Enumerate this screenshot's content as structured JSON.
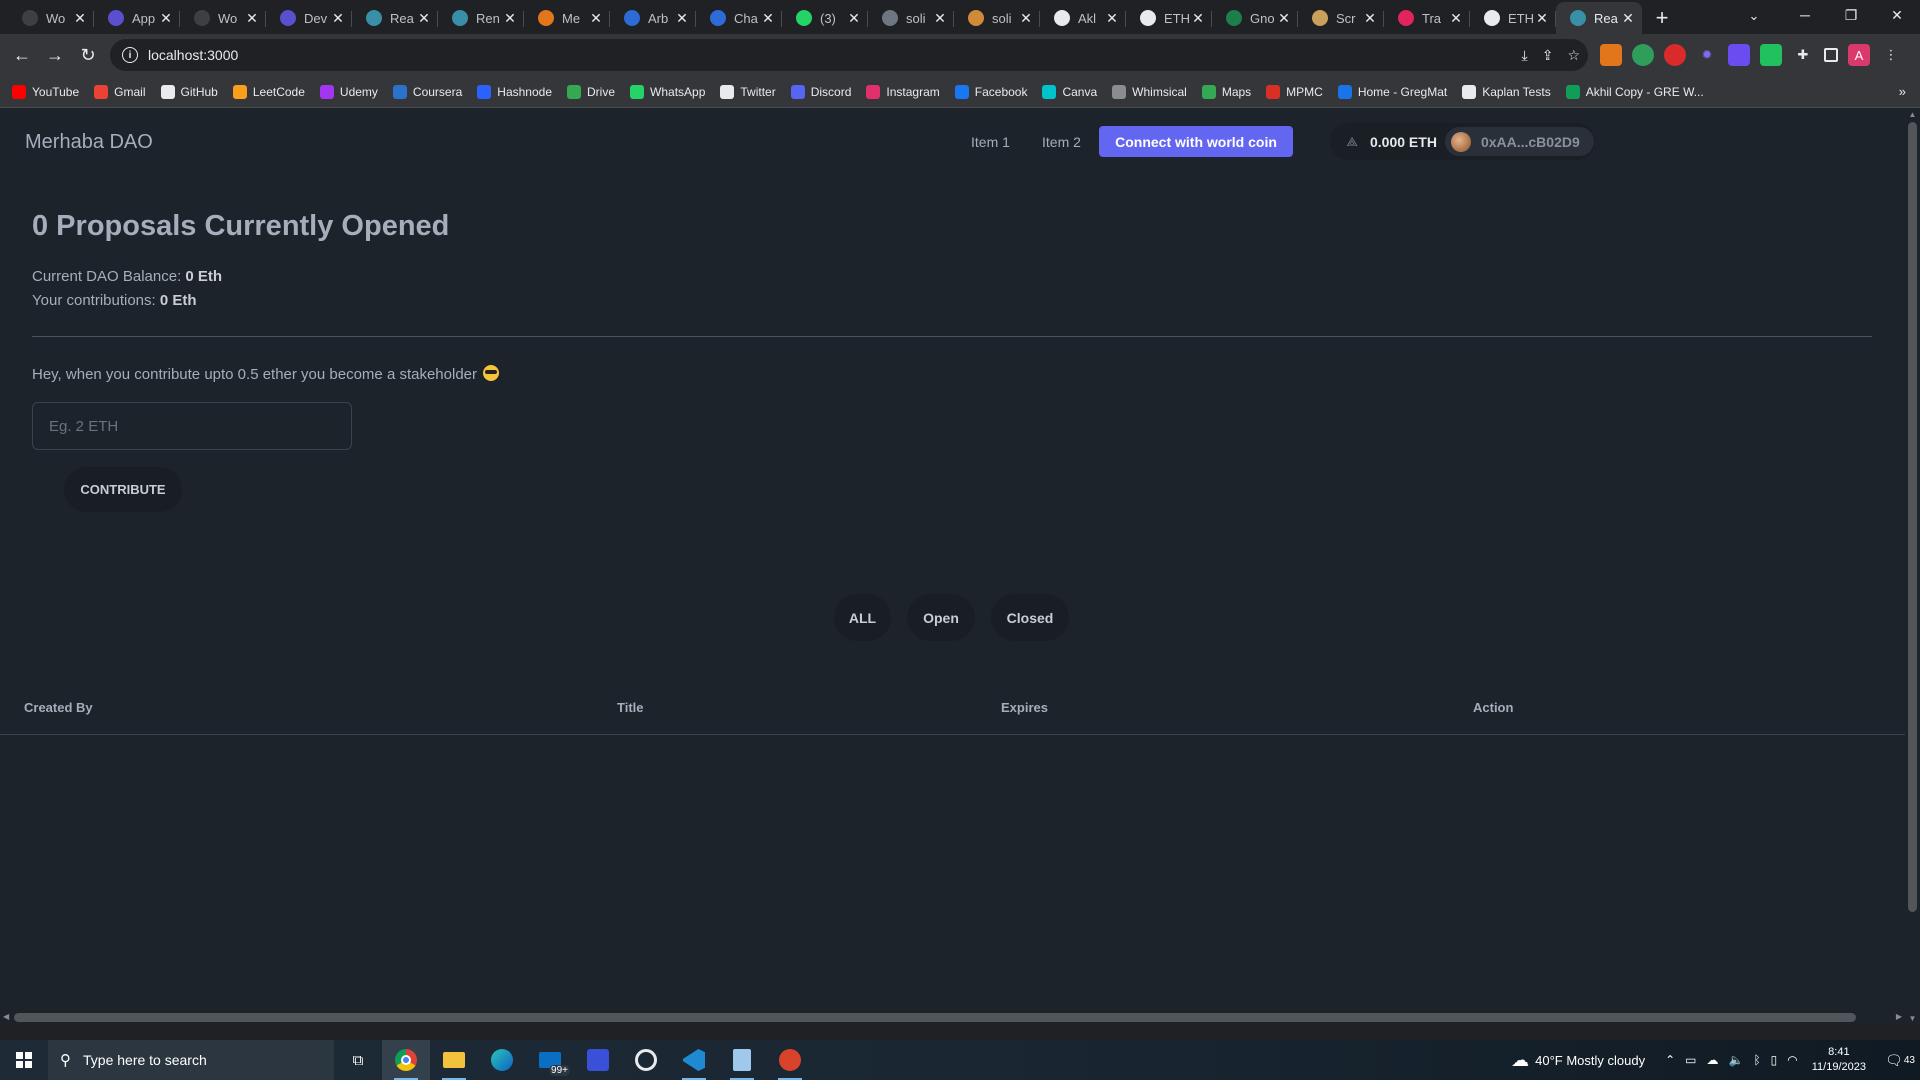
{
  "browser": {
    "tabs": [
      {
        "title": "Wo",
        "color": "#3c4043"
      },
      {
        "title": "App",
        "color": "#5a4fcf"
      },
      {
        "title": "Wo",
        "color": "#3c4043"
      },
      {
        "title": "Dev",
        "color": "#5a4fcf"
      },
      {
        "title": "Rea",
        "color": "#3a8fa8"
      },
      {
        "title": "Ren",
        "color": "#3a8fa8"
      },
      {
        "title": "Me",
        "color": "#e2761b"
      },
      {
        "title": "Arb",
        "color": "#2d6bd6"
      },
      {
        "title": "Cha",
        "color": "#2d6bd6"
      },
      {
        "title": "(3)",
        "color": "#25d366"
      },
      {
        "title": "soli",
        "color": "#6e7681"
      },
      {
        "title": "soli",
        "color": "#d08a3a"
      },
      {
        "title": "Akl",
        "color": "#e8eaed"
      },
      {
        "title": "ETH",
        "color": "#e8eaed"
      },
      {
        "title": "Gno",
        "color": "#1a7f4b"
      },
      {
        "title": "Scr",
        "color": "#c9a15b"
      },
      {
        "title": "Tra",
        "color": "#e0245e"
      },
      {
        "title": "ETH",
        "color": "#e8eaed"
      },
      {
        "title": "Rea",
        "color": "#3a8fa8"
      }
    ],
    "active_tab_index": 18,
    "url": "localhost:3000",
    "bookmarks": [
      {
        "label": "YouTube",
        "color": "#ff0000"
      },
      {
        "label": "Gmail",
        "color": "#ea4335"
      },
      {
        "label": "GitHub",
        "color": "#e8eaed"
      },
      {
        "label": "LeetCode",
        "color": "#f89f1b"
      },
      {
        "label": "Udemy",
        "color": "#a435f0"
      },
      {
        "label": "Coursera",
        "color": "#2a73cc"
      },
      {
        "label": "Hashnode",
        "color": "#2962ff"
      },
      {
        "label": "Drive",
        "color": "#34a853"
      },
      {
        "label": "WhatsApp",
        "color": "#25d366"
      },
      {
        "label": "Twitter",
        "color": "#e8eaed"
      },
      {
        "label": "Discord",
        "color": "#5865f2"
      },
      {
        "label": "Instagram",
        "color": "#e1306c"
      },
      {
        "label": "Facebook",
        "color": "#1877f2"
      },
      {
        "label": "Canva",
        "color": "#00c4cc"
      },
      {
        "label": "Whimsical",
        "color": "#8a8d90"
      },
      {
        "label": "Maps",
        "color": "#34a853"
      },
      {
        "label": "MPMC",
        "color": "#d93025"
      },
      {
        "label": "Home - GregMat",
        "color": "#1a73e8"
      },
      {
        "label": "Kaplan Tests",
        "color": "#e8eaed"
      },
      {
        "label": "Akhil Copy - GRE W...",
        "color": "#0f9d58"
      }
    ]
  },
  "app": {
    "brand": "Merhaba DAO",
    "nav": {
      "item1": "Item 1",
      "item2": "Item 2",
      "connect": "Connect with world coin"
    },
    "wallet": {
      "balance": "0.000 ETH",
      "address": "0xAA...cB02D9"
    },
    "headline": "0 Proposals Currently Opened",
    "stats": {
      "balance_label": "Current DAO Balance:",
      "balance_value": "0 Eth",
      "contrib_label": "Your contributions:",
      "contrib_value": "0 Eth"
    },
    "promo": "Hey, when you contribute upto 0.5 ether you become a stakeholder",
    "amount_placeholder": "Eg. 2 ETH",
    "contribute_button": "CONTRIBUTE",
    "filters": {
      "all": "ALL",
      "open": "Open",
      "closed": "Closed"
    },
    "table": {
      "headers": [
        "Created By",
        "Title",
        "Expires",
        "Action"
      ],
      "rows": []
    },
    "accent_color": "#6266f1"
  },
  "taskbar": {
    "search_placeholder": "Type here to search",
    "mail_badge": "99+",
    "weather": "40°F  Mostly cloudy",
    "time": "8:41",
    "date": "11/19/2023",
    "notifications": "43"
  }
}
